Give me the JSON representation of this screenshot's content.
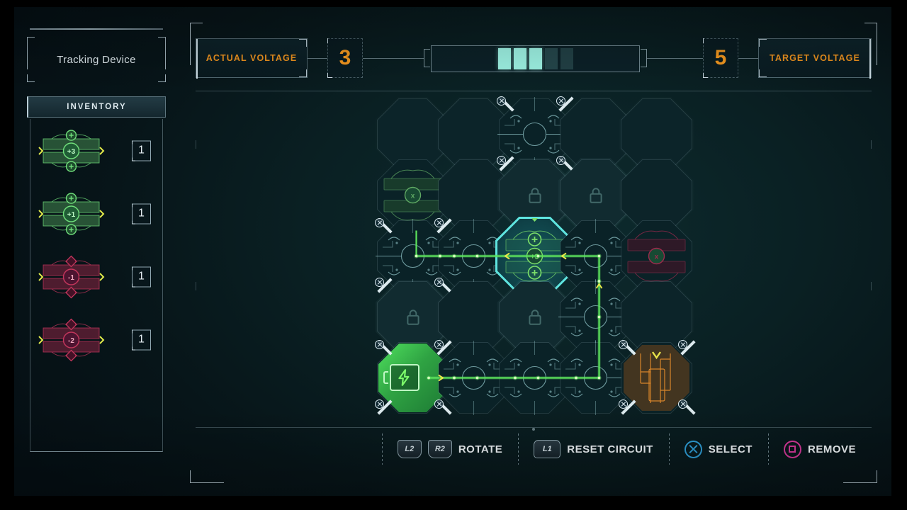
{
  "sidebar": {
    "title": "Tracking Device",
    "inventory_tab_label": "INVENTORY",
    "items": [
      {
        "name": "voltage-booster-3",
        "value": "+3",
        "qty": "1",
        "polarity": "positive",
        "color": "#6fdc7a"
      },
      {
        "name": "voltage-booster-1",
        "value": "+1",
        "qty": "1",
        "polarity": "positive",
        "color": "#6fdc7a"
      },
      {
        "name": "voltage-resistor-1",
        "value": "-1",
        "qty": "1",
        "polarity": "negative",
        "color": "#c2365c"
      },
      {
        "name": "voltage-resistor-2",
        "value": "-2",
        "qty": "1",
        "polarity": "negative",
        "color": "#c2365c"
      }
    ]
  },
  "header": {
    "actual_voltage_label": "ACTUAL VOLTAGE",
    "actual_voltage_value": "3",
    "target_voltage_label": "TARGET VOLTAGE",
    "target_voltage_value": "5",
    "accent_color": "#f0941f",
    "meter": {
      "total_segments": 5,
      "filled_segments": 3,
      "filled_color": "#9ff5e6",
      "empty_color": "#2a4d52"
    }
  },
  "grid": {
    "columns": 5,
    "rows": 5,
    "selected_tile": {
      "row": 2,
      "col": 2,
      "value": "+3",
      "highlight_color": "#5fe5e0"
    },
    "cells": [
      {
        "row": 0,
        "col": 0,
        "type": "empty"
      },
      {
        "row": 0,
        "col": 1,
        "type": "empty"
      },
      {
        "row": 0,
        "col": 2,
        "type": "conduit",
        "state": "active-node"
      },
      {
        "row": 0,
        "col": 3,
        "type": "empty"
      },
      {
        "row": 0,
        "col": 4,
        "type": "empty"
      },
      {
        "row": 1,
        "col": 0,
        "type": "tile-positive"
      },
      {
        "row": 1,
        "col": 1,
        "type": "empty"
      },
      {
        "row": 1,
        "col": 2,
        "type": "locked"
      },
      {
        "row": 1,
        "col": 3,
        "type": "locked"
      },
      {
        "row": 1,
        "col": 4,
        "type": "empty"
      },
      {
        "row": 2,
        "col": 0,
        "type": "conduit"
      },
      {
        "row": 2,
        "col": 1,
        "type": "conduit"
      },
      {
        "row": 2,
        "col": 2,
        "type": "tile-selected",
        "value": "+3"
      },
      {
        "row": 2,
        "col": 3,
        "type": "conduit"
      },
      {
        "row": 2,
        "col": 4,
        "type": "tile-negative"
      },
      {
        "row": 3,
        "col": 0,
        "type": "locked"
      },
      {
        "row": 3,
        "col": 1,
        "type": "empty"
      },
      {
        "row": 3,
        "col": 2,
        "type": "locked"
      },
      {
        "row": 3,
        "col": 3,
        "type": "conduit"
      },
      {
        "row": 3,
        "col": 4,
        "type": "empty"
      },
      {
        "row": 4,
        "col": 0,
        "type": "battery-source"
      },
      {
        "row": 4,
        "col": 1,
        "type": "conduit"
      },
      {
        "row": 4,
        "col": 2,
        "type": "conduit"
      },
      {
        "row": 4,
        "col": 3,
        "type": "conduit"
      },
      {
        "row": 4,
        "col": 4,
        "type": "target-node"
      }
    ],
    "wire_color": "#5ce35c"
  },
  "controls": [
    {
      "name": "rotate",
      "buttons": [
        "L2",
        "R2"
      ],
      "label": "ROTATE",
      "type": "trigger"
    },
    {
      "name": "reset-circuit",
      "buttons": [
        "L1"
      ],
      "label": "RESET CIRCUIT",
      "type": "trigger"
    },
    {
      "name": "select",
      "buttons": [
        "cross"
      ],
      "label": "SELECT",
      "type": "face",
      "color": "#2f9fd8"
    },
    {
      "name": "remove",
      "buttons": [
        "square"
      ],
      "label": "REMOVE",
      "type": "face",
      "color": "#d6399b"
    }
  ]
}
